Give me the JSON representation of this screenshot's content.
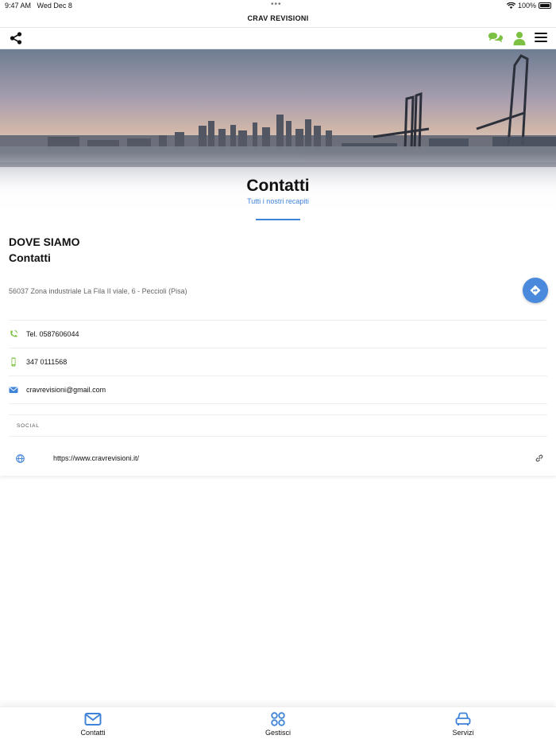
{
  "status": {
    "time": "9:47 AM",
    "date": "Wed Dec 8",
    "battery": "100%"
  },
  "app": {
    "title": "CRAV REVISIONI"
  },
  "toolbar": {
    "icons": [
      "share-icon",
      "chat-icon",
      "user-icon",
      "menu-icon"
    ],
    "accent": "#7cc142"
  },
  "hero": {
    "title": "Contatti",
    "subtitle": "Tutti i nostri recapiti",
    "accent": "#3f83d8"
  },
  "contact": {
    "title_line1": "DOVE SIAMO",
    "title_line2": "Contatti",
    "address": "56037 Zona industriale La Fila II viale, 6 - Peccioli (Pisa)",
    "phone": "Tel. 0587606044",
    "mobile": "347 0111568",
    "email": "cravrevisioni@gmail.com",
    "social_label": "SOCIAL",
    "website": "https://www.cravrevisioni.it/"
  },
  "tabs": [
    {
      "label": "Contatti",
      "icon": "mail-icon"
    },
    {
      "label": "Gestisci",
      "icon": "grid-icon"
    },
    {
      "label": "Servizi",
      "icon": "car-icon"
    }
  ],
  "colors": {
    "primary": "#3f83d8",
    "green": "#7cc142"
  }
}
